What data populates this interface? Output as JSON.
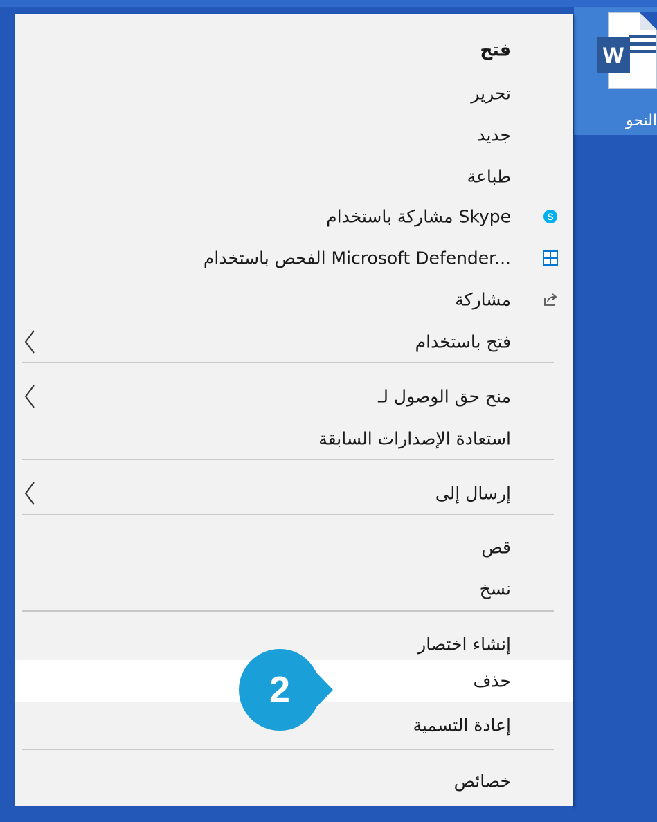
{
  "desktop": {
    "file_label": "النحو",
    "word_badge": "W"
  },
  "menu": {
    "items": [
      {
        "label": "فتح",
        "bold": true
      },
      {
        "label": "تحرير"
      },
      {
        "label": "جديد"
      },
      {
        "label": "طباعة"
      },
      {
        "label": "مشاركة باستخدام Skype",
        "icon": "skype-icon"
      },
      {
        "label": "الفحص باستخدام Microsoft Defender...",
        "icon": "defender-shield-icon"
      },
      {
        "label": "مشاركة",
        "icon": "share-icon"
      },
      {
        "label": "فتح باستخدام",
        "submenu": true
      },
      {
        "label": "منح حق الوصول لـ",
        "submenu": true
      },
      {
        "label": "استعادة الإصدارات السابقة"
      },
      {
        "label": "إرسال إلى",
        "submenu": true
      },
      {
        "label": "قص"
      },
      {
        "label": "نسخ"
      },
      {
        "label": "إنشاء اختصار"
      },
      {
        "label": "حذف",
        "highlighted": true
      },
      {
        "label": "إعادة التسمية"
      },
      {
        "label": "خصائص"
      }
    ]
  },
  "callout": {
    "number": "2",
    "color": "#1a9fd9"
  },
  "colors": {
    "desktop_blue": "#2358b8",
    "menu_background": "#f2f2f2",
    "highlight": "#ffffff",
    "skype_blue": "#00aff0",
    "defender_blue": "#0078d4"
  }
}
